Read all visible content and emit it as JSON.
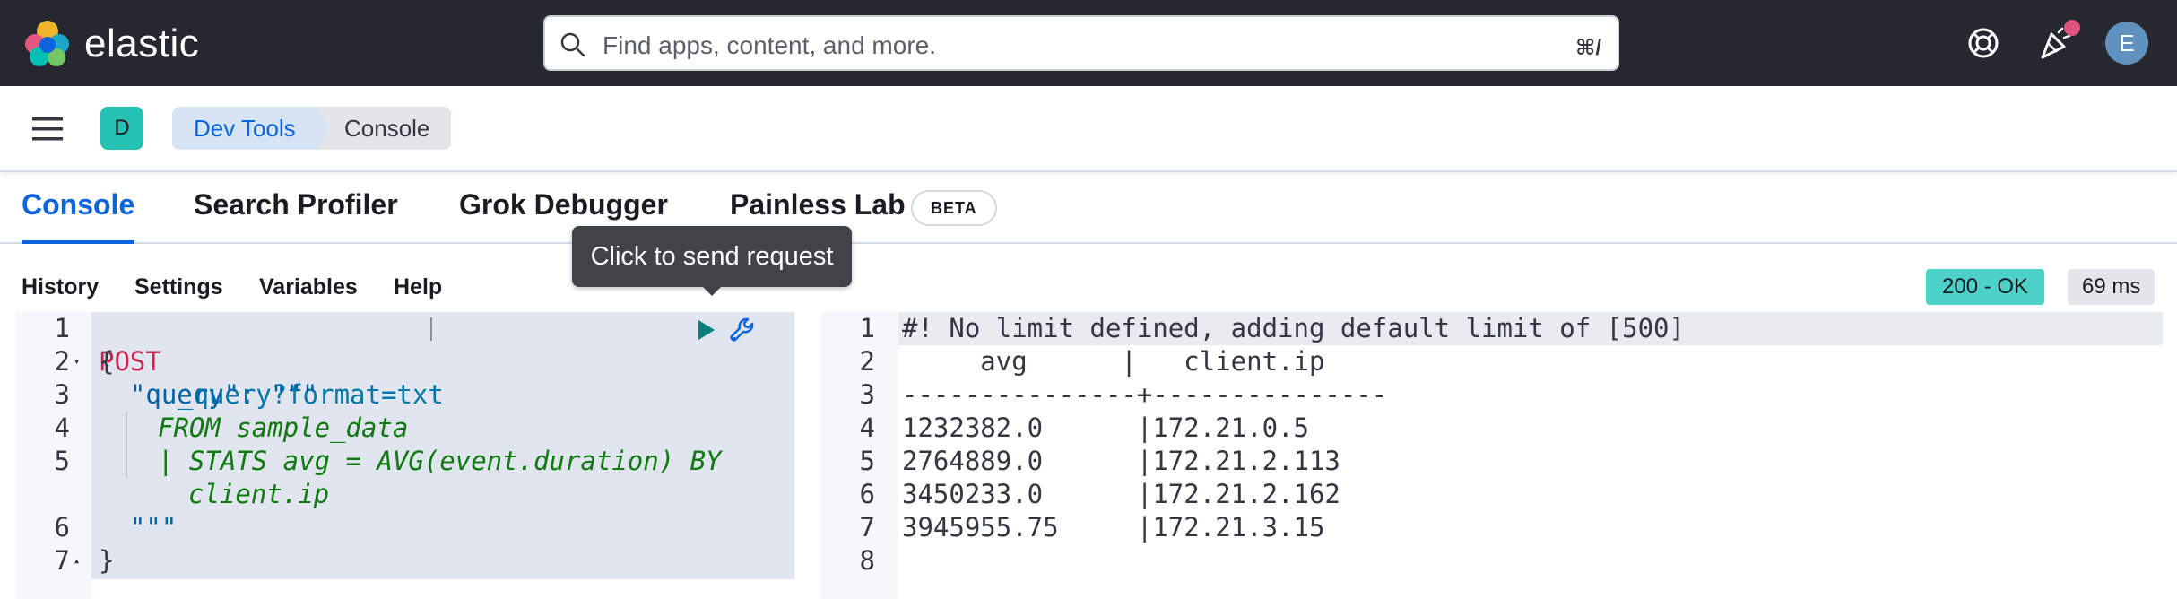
{
  "header": {
    "brand": "elastic",
    "search_placeholder": "Find apps, content, and more.",
    "search_shortcut": "⌘/",
    "icons": [
      "help-icon",
      "newsfeed-icon"
    ],
    "avatar_initial": "E"
  },
  "subheader": {
    "space_initial": "D",
    "breadcrumbs": [
      "Dev Tools",
      "Console"
    ]
  },
  "tabs": [
    {
      "label": "Console",
      "active": true
    },
    {
      "label": "Search Profiler",
      "active": false
    },
    {
      "label": "Grok Debugger",
      "active": false
    },
    {
      "label": "Painless Lab",
      "active": false,
      "badge": "BETA"
    }
  ],
  "console_menu": [
    "History",
    "Settings",
    "Variables",
    "Help"
  ],
  "tooltip": "Click to send request",
  "status": {
    "code": "200 - OK",
    "time": "69 ms",
    "color": "#4dd2ca"
  },
  "request_editor": {
    "lines": [
      {
        "n": "1",
        "method": "POST",
        "path": "_query?format=txt"
      },
      {
        "n": "2",
        "text": "{"
      },
      {
        "n": "3",
        "text": "  \"query\": \"\"\""
      },
      {
        "n": "4",
        "text": "FROM sample_data"
      },
      {
        "n": "5",
        "text": "| STATS avg = AVG(event.duration) BY",
        "cont": "client.ip"
      },
      {
        "n": "6",
        "text": "  \"\"\""
      },
      {
        "n": "7",
        "text": "}"
      }
    ]
  },
  "response_editor": {
    "lines": [
      {
        "n": "1",
        "text": "#! No limit defined, adding default limit of [500]"
      },
      {
        "n": "2",
        "text": "     avg      |   client.ip   "
      },
      {
        "n": "3",
        "text": "---------------+---------------"
      },
      {
        "n": "4",
        "text": "1232382.0      |172.21.0.5"
      },
      {
        "n": "5",
        "text": "2764889.0      |172.21.2.113"
      },
      {
        "n": "6",
        "text": "3450233.0      |172.21.2.162"
      },
      {
        "n": "7",
        "text": "3945955.75     |172.21.3.15"
      },
      {
        "n": "8",
        "text": ""
      }
    ]
  }
}
